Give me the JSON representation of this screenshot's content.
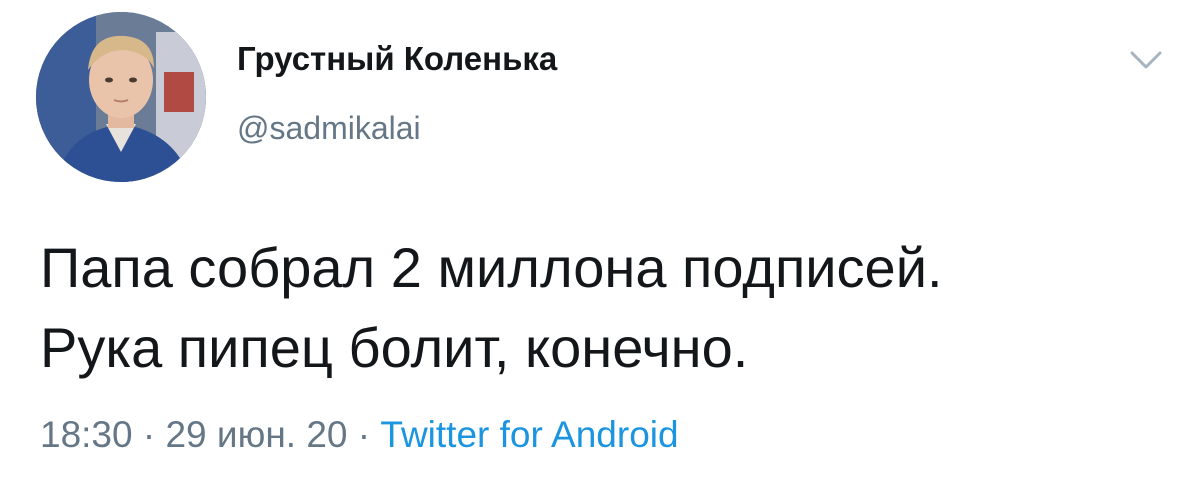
{
  "tweet": {
    "author": {
      "display_name": "Грустный Коленька",
      "handle": "@sadmikalai",
      "avatar": "profile-photo"
    },
    "menu_icon": "chevron-down-icon",
    "text_lines": [
      "Папа собрал 2 миллона подписей.",
      "Рука пипец болит, конечно."
    ],
    "meta": {
      "time": "18:30",
      "separator": " · ",
      "date": "29 июн. 20",
      "source": "Twitter for Android"
    }
  },
  "colors": {
    "text": "#14171a",
    "secondary": "#657786",
    "link": "#1b95e0",
    "background": "#ffffff"
  }
}
